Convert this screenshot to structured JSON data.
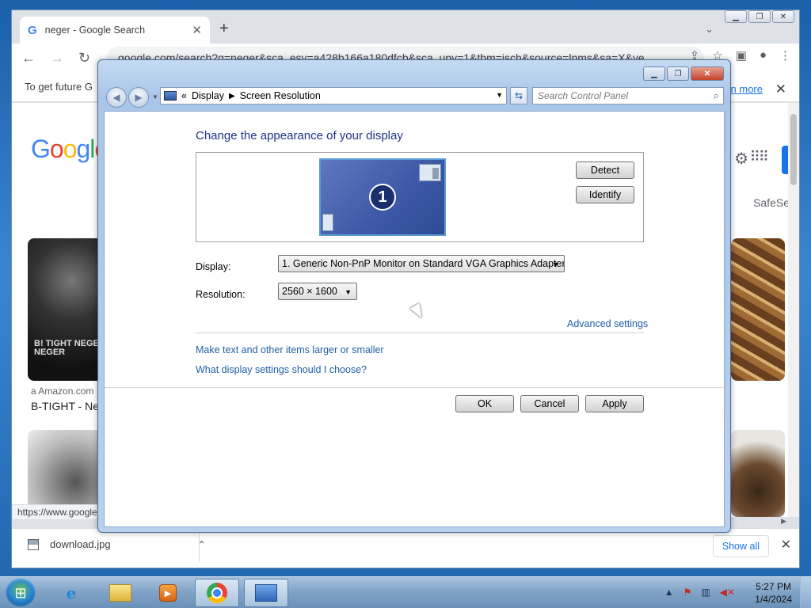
{
  "browser": {
    "tab_title": "neger - Google Search",
    "url": "google.com/search?q=neger&sca_esv=a428b166a180dfcb&sca_upv=1&tbm=isch&source=lnms&sa=X&ve",
    "infobar_text": "To get future G",
    "learn_more": "n more",
    "safesearch": "SafeSe",
    "result_source": "Amazon.com",
    "result_title": "B-TIGHT - Ne",
    "thumb_text": "B! TIGHT NEGER NEGER",
    "status_url": "https://www.google",
    "download_file": "download.jpg",
    "show_all": "Show all"
  },
  "dialog": {
    "breadcrumb_root": "Display",
    "breadcrumb_page": "Screen Resolution",
    "search_placeholder": "Search Control Panel",
    "heading": "Change the appearance of your display",
    "monitor_number": "1",
    "detect_label": "Detect",
    "identify_label": "Identify",
    "display_label": "Display:",
    "display_value": "1. Generic Non-PnP Monitor on Standard VGA Graphics Adapter",
    "resolution_label": "Resolution:",
    "resolution_value": "2560 × 1600",
    "advanced_settings": "Advanced settings",
    "link_text_size": "Make text and other items larger or smaller",
    "link_help": "What display settings should I choose?",
    "ok_label": "OK",
    "cancel_label": "Cancel",
    "apply_label": "Apply"
  },
  "taskbar": {
    "time": "5:27 PM",
    "date": "1/4/2024"
  },
  "icons": {
    "google": "google-g-icon",
    "monitor": "monitor-icon",
    "search": "search-icon",
    "refresh": "refresh-icon"
  }
}
